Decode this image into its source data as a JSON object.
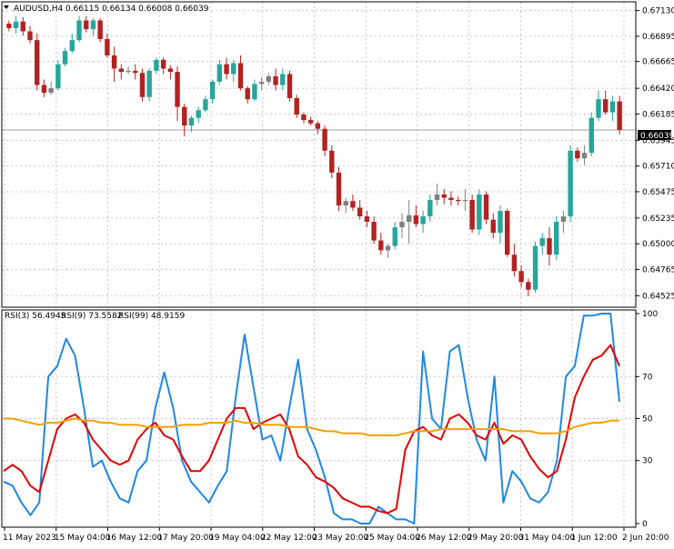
{
  "chart_data": [
    {
      "type": "candlestick",
      "title": "AUDUSD,H4",
      "ohlc_header": "0.66115 0.66134 0.66008 0.66039",
      "ylim": [
        0.6442,
        0.6721
      ],
      "yticks": [
        "0.67130",
        "0.66895",
        "0.66665",
        "0.66420",
        "0.66185",
        "0.65945",
        "0.65710",
        "0.65475",
        "0.65235",
        "0.65000",
        "0.64765",
        "0.64525"
      ],
      "current_price_label": "0.66039",
      "current_price": 0.66039,
      "colors": {
        "bull": "#26a69a",
        "bear": "#b22222",
        "doji": "#808080",
        "bull_mark": "#26a69a"
      },
      "candles": [
        [
          0.6701,
          0.6704,
          0.6694,
          0.6697
        ],
        [
          0.6697,
          0.6708,
          0.6692,
          0.6703
        ],
        [
          0.6703,
          0.6707,
          0.669,
          0.6694
        ],
        [
          0.6694,
          0.6699,
          0.6683,
          0.6686
        ],
        [
          0.6686,
          0.6692,
          0.664,
          0.6645
        ],
        [
          0.6645,
          0.665,
          0.6634,
          0.6638
        ],
        [
          0.6638,
          0.6648,
          0.6636,
          0.6642
        ],
        [
          0.6642,
          0.6668,
          0.664,
          0.6664
        ],
        [
          0.6664,
          0.6679,
          0.6662,
          0.6676
        ],
        [
          0.6676,
          0.6692,
          0.6674,
          0.6686
        ],
        [
          0.6686,
          0.6708,
          0.6684,
          0.6704
        ],
        [
          0.6704,
          0.6708,
          0.6693,
          0.6696
        ],
        [
          0.6696,
          0.6706,
          0.669,
          0.6704
        ],
        [
          0.6704,
          0.6706,
          0.6684,
          0.6687
        ],
        [
          0.6687,
          0.6692,
          0.667,
          0.6672
        ],
        [
          0.6672,
          0.668,
          0.6648,
          0.666
        ],
        [
          0.666,
          0.6664,
          0.665,
          0.6657
        ],
        [
          0.6657,
          0.6662,
          0.6655,
          0.6658
        ],
        [
          0.6658,
          0.6664,
          0.665,
          0.6656
        ],
        [
          0.6656,
          0.666,
          0.663,
          0.6634
        ],
        [
          0.6634,
          0.666,
          0.663,
          0.6658
        ],
        [
          0.6658,
          0.667,
          0.6655,
          0.6668
        ],
        [
          0.6668,
          0.667,
          0.6655,
          0.666
        ],
        [
          0.666,
          0.6663,
          0.665,
          0.6657
        ],
        [
          0.6657,
          0.6662,
          0.6612,
          0.6625
        ],
        [
          0.6625,
          0.6628,
          0.6598,
          0.6608
        ],
        [
          0.6608,
          0.6617,
          0.6602,
          0.6615
        ],
        [
          0.6615,
          0.6625,
          0.661,
          0.6622
        ],
        [
          0.6622,
          0.6635,
          0.662,
          0.6632
        ],
        [
          0.6632,
          0.665,
          0.6628,
          0.6648
        ],
        [
          0.6648,
          0.6668,
          0.6645,
          0.6664
        ],
        [
          0.6664,
          0.667,
          0.665,
          0.6655
        ],
        [
          0.6655,
          0.6668,
          0.6648,
          0.6665
        ],
        [
          0.6665,
          0.6672,
          0.664,
          0.6642
        ],
        [
          0.6642,
          0.6644,
          0.6628,
          0.6632
        ],
        [
          0.6632,
          0.665,
          0.663,
          0.6646
        ],
        [
          0.6646,
          0.6652,
          0.664,
          0.6648
        ],
        [
          0.6648,
          0.6656,
          0.6645,
          0.6653
        ],
        [
          0.6653,
          0.666,
          0.664,
          0.6645
        ],
        [
          0.6645,
          0.666,
          0.664,
          0.6655
        ],
        [
          0.6655,
          0.6658,
          0.663,
          0.6633
        ],
        [
          0.6633,
          0.6636,
          0.6615,
          0.6618
        ],
        [
          0.6618,
          0.662,
          0.661,
          0.6613
        ],
        [
          0.6613,
          0.6616,
          0.6608,
          0.661
        ],
        [
          0.661,
          0.6612,
          0.66,
          0.6605
        ],
        [
          0.6605,
          0.6608,
          0.658,
          0.6585
        ],
        [
          0.6585,
          0.659,
          0.656,
          0.6565
        ],
        [
          0.6565,
          0.657,
          0.653,
          0.6535
        ],
        [
          0.6535,
          0.6542,
          0.6528,
          0.6539
        ],
        [
          0.6539,
          0.6545,
          0.653,
          0.6533
        ],
        [
          0.6533,
          0.654,
          0.6522,
          0.6525
        ],
        [
          0.6525,
          0.653,
          0.6515,
          0.652
        ],
        [
          0.652,
          0.6525,
          0.65,
          0.6503
        ],
        [
          0.6503,
          0.651,
          0.649,
          0.6494
        ],
        [
          0.6494,
          0.65,
          0.6487,
          0.6498
        ],
        [
          0.6498,
          0.652,
          0.6495,
          0.6515
        ],
        [
          0.6515,
          0.6528,
          0.6505,
          0.652
        ],
        [
          0.652,
          0.654,
          0.65,
          0.6526
        ],
        [
          0.6526,
          0.6535,
          0.6515,
          0.6518
        ],
        [
          0.6518,
          0.653,
          0.651,
          0.6525
        ],
        [
          0.6525,
          0.6545,
          0.652,
          0.654
        ],
        [
          0.654,
          0.6555,
          0.6535,
          0.6545
        ],
        [
          0.6545,
          0.655,
          0.6536,
          0.6542
        ],
        [
          0.6542,
          0.6548,
          0.6535,
          0.654
        ],
        [
          0.654,
          0.6543,
          0.6535,
          0.6539
        ],
        [
          0.6539,
          0.655,
          0.653,
          0.654
        ],
        [
          0.654,
          0.6545,
          0.651,
          0.6513
        ],
        [
          0.6513,
          0.655,
          0.6508,
          0.6545
        ],
        [
          0.6545,
          0.6548,
          0.6518,
          0.6522
        ],
        [
          0.6522,
          0.6528,
          0.6505,
          0.651
        ],
        [
          0.651,
          0.6535,
          0.65,
          0.653
        ],
        [
          0.653,
          0.6532,
          0.6488,
          0.649
        ],
        [
          0.649,
          0.65,
          0.647,
          0.6475
        ],
        [
          0.6475,
          0.648,
          0.646,
          0.6465
        ],
        [
          0.6465,
          0.6468,
          0.6452,
          0.6458
        ],
        [
          0.6458,
          0.6502,
          0.6455,
          0.6498
        ],
        [
          0.6498,
          0.651,
          0.649,
          0.6505
        ],
        [
          0.6505,
          0.6515,
          0.648,
          0.649
        ],
        [
          0.649,
          0.6525,
          0.6485,
          0.652
        ],
        [
          0.652,
          0.653,
          0.651,
          0.6525
        ],
        [
          0.6525,
          0.659,
          0.652,
          0.6585
        ],
        [
          0.6585,
          0.6588,
          0.6575,
          0.6578
        ],
        [
          0.6578,
          0.659,
          0.6572,
          0.6583
        ],
        [
          0.6583,
          0.662,
          0.658,
          0.6615
        ],
        [
          0.6615,
          0.664,
          0.6612,
          0.6632
        ],
        [
          0.6632,
          0.664,
          0.6618,
          0.662
        ],
        [
          0.662,
          0.6635,
          0.6612,
          0.663
        ],
        [
          0.663,
          0.6635,
          0.66,
          0.6604
        ]
      ],
      "x_tick_labels": [
        "11 May 2023",
        "15 May 04:00",
        "16 May 12:00",
        "17 May 20:00",
        "19 May 04:00",
        "22 May 12:00",
        "23 May 20:00",
        "25 May 04:00",
        "26 May 12:00",
        "29 May 20:00",
        "31 May 04:00",
        "1 Jun 12:00",
        "2 Jun 20:00"
      ]
    },
    {
      "type": "line",
      "legend": [
        "RSI(3) 56.4945",
        "RSI(9) 73.5582",
        "RSI(99) 48.9159"
      ],
      "ylim": [
        0,
        100
      ],
      "yticks": [
        "100",
        "70",
        "50",
        "30",
        "0"
      ],
      "ytick_values": [
        100,
        70,
        50,
        30,
        0
      ],
      "series": [
        {
          "name": "RSI(3)",
          "color": "#1e88e5",
          "values": [
            20,
            18,
            10,
            4,
            10,
            70,
            75,
            88,
            80,
            55,
            27,
            30,
            20,
            12,
            10,
            25,
            30,
            55,
            72,
            55,
            30,
            20,
            15,
            10,
            18,
            25,
            60,
            90,
            65,
            40,
            42,
            30,
            55,
            78,
            45,
            35,
            22,
            5,
            2,
            2,
            0,
            0,
            8,
            5,
            2,
            2,
            0,
            82,
            50,
            45,
            82,
            85,
            60,
            40,
            30,
            70,
            10,
            25,
            20,
            12,
            10,
            15,
            30,
            70,
            75,
            99,
            99,
            100,
            100,
            58
          ]
        },
        {
          "name": "RSI(9)",
          "color": "#e60000",
          "values": [
            25,
            28,
            25,
            18,
            15,
            30,
            45,
            50,
            52,
            48,
            40,
            35,
            30,
            28,
            30,
            40,
            45,
            48,
            42,
            40,
            32,
            25,
            25,
            30,
            40,
            50,
            55,
            55,
            45,
            48,
            50,
            52,
            45,
            32,
            28,
            22,
            20,
            17,
            12,
            10,
            8,
            8,
            6,
            5,
            7,
            35,
            44,
            46,
            42,
            40,
            50,
            52,
            48,
            42,
            40,
            48,
            38,
            42,
            40,
            32,
            26,
            22,
            25,
            40,
            60,
            70,
            78,
            80,
            85,
            75
          ]
        },
        {
          "name": "RSI(99)",
          "color": "#f5a000",
          "values": [
            50,
            50,
            49,
            48,
            47,
            48,
            48,
            49,
            50,
            49,
            49,
            48,
            48,
            47,
            47,
            47,
            46,
            46,
            46,
            46,
            47,
            47,
            47,
            48,
            48,
            48,
            49,
            48,
            48,
            47,
            47,
            47,
            46,
            46,
            46,
            45,
            44,
            44,
            43,
            43,
            43,
            42,
            42,
            42,
            42,
            43,
            44,
            44,
            44,
            45,
            45,
            45,
            45,
            45,
            45,
            45,
            45,
            44,
            44,
            44,
            43,
            43,
            43,
            44,
            46,
            47,
            48,
            48,
            49,
            49
          ]
        }
      ]
    }
  ]
}
